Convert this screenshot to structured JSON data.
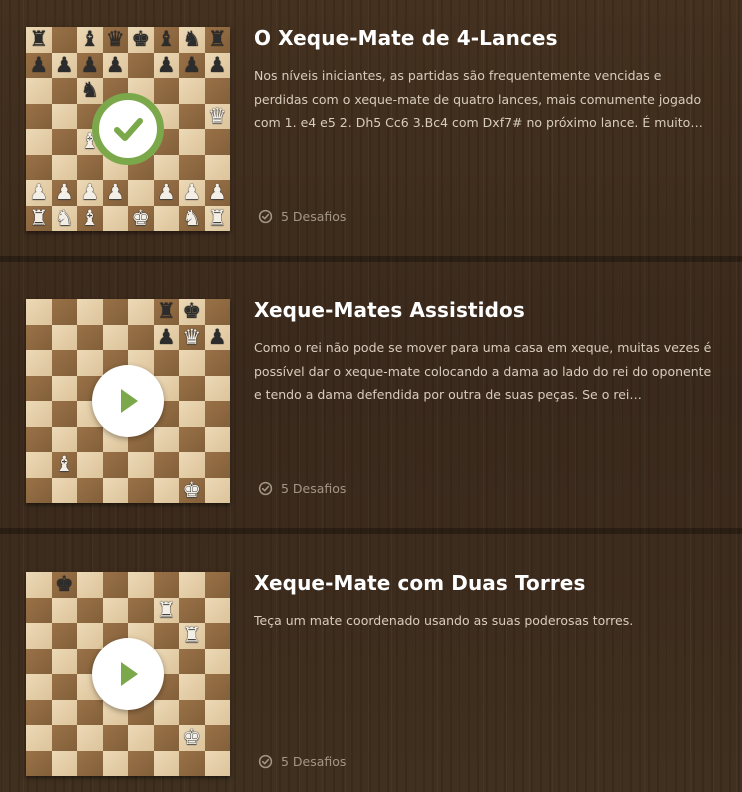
{
  "lessons": [
    {
      "title": "O Xeque-Mate de 4-Lances",
      "description": "Nos níveis iniciantes, as partidas são frequentemente vencidas e perdidas com o xeque-mate de quatro lances, mais comumente jogado com 1. e4 e5 2. Dh5 Cc6 3.Bc4 com Dxf7# no próximo lance. É muito…",
      "challenges": "5 Desafios",
      "status": "completed",
      "status_icon": "check-icon",
      "status_color": "#7aa84a",
      "board": [
        [
          "r",
          "",
          "b",
          "q",
          "k",
          "b",
          "n",
          "r"
        ],
        [
          "p",
          "p",
          "p",
          "p",
          "",
          "p",
          "p",
          "p"
        ],
        [
          "",
          "",
          "n",
          "",
          "",
          "",
          "",
          ""
        ],
        [
          "",
          "",
          "",
          "",
          "p",
          "",
          "",
          "Q"
        ],
        [
          "",
          "",
          "B",
          "",
          "P",
          "",
          "",
          ""
        ],
        [
          "",
          "",
          "",
          "",
          "",
          "",
          "",
          ""
        ],
        [
          "P",
          "P",
          "P",
          "P",
          "",
          "P",
          "P",
          "P"
        ],
        [
          "R",
          "N",
          "B",
          "",
          "K",
          "",
          "N",
          "R"
        ]
      ]
    },
    {
      "title": "Xeque-Mates Assistidos",
      "description": "Como o rei não pode se mover para uma casa em xeque, muitas vezes é possível dar o xeque-mate colocando a dama ao lado do rei do oponente e tendo a dama defendida por outra de suas peças. Se o rei…",
      "challenges": "5 Desafios",
      "status": "not-started",
      "status_icon": "play-icon",
      "status_color": "#7aa84a",
      "board": [
        [
          "",
          "",
          "",
          "",
          "",
          "r",
          "k",
          ""
        ],
        [
          "",
          "",
          "",
          "",
          "",
          "p",
          "Q",
          "p"
        ],
        [
          "",
          "",
          "",
          "",
          "",
          "",
          "",
          ""
        ],
        [
          "",
          "",
          "",
          "",
          "",
          "",
          "",
          ""
        ],
        [
          "",
          "",
          "",
          "",
          "",
          "",
          "",
          ""
        ],
        [
          "",
          "",
          "",
          "",
          "",
          "",
          "",
          ""
        ],
        [
          "",
          "B",
          "",
          "",
          "",
          "",
          "",
          ""
        ],
        [
          "",
          "",
          "",
          "",
          "",
          "",
          "K",
          ""
        ]
      ]
    },
    {
      "title": "Xeque-Mate com Duas Torres",
      "description": "Teça um mate coordenado usando as suas poderosas torres.",
      "challenges": "5 Desafios",
      "status": "not-started",
      "status_icon": "play-icon",
      "status_color": "#7aa84a",
      "board": [
        [
          "",
          "k",
          "",
          "",
          "",
          "",
          "",
          ""
        ],
        [
          "",
          "",
          "",
          "",
          "",
          "R",
          "",
          ""
        ],
        [
          "",
          "",
          "",
          "",
          "",
          "",
          "R",
          ""
        ],
        [
          "",
          "",
          "",
          "",
          "",
          "",
          "",
          ""
        ],
        [
          "",
          "",
          "",
          "",
          "",
          "",
          "",
          ""
        ],
        [
          "",
          "",
          "",
          "",
          "",
          "",
          "",
          ""
        ],
        [
          "",
          "",
          "",
          "",
          "",
          "",
          "K",
          ""
        ],
        [
          "",
          "",
          "",
          "",
          "",
          "",
          "",
          ""
        ]
      ]
    }
  ]
}
